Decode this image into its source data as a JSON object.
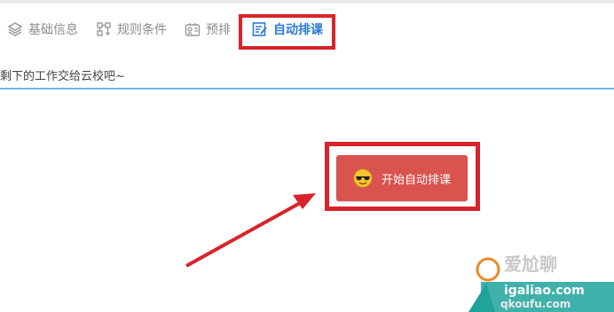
{
  "tabs": [
    {
      "label": "基础信息",
      "icon": "layers-icon",
      "active": false
    },
    {
      "label": "规则条件",
      "icon": "rules-icon",
      "active": false
    },
    {
      "label": "预排",
      "icon": "pre-schedule-icon",
      "active": false
    },
    {
      "label": "自动排课",
      "icon": "auto-schedule-icon",
      "active": true
    }
  ],
  "hint_text": "剩下的工作交给云校吧~",
  "start_button": {
    "label": "开始自动排课",
    "icon": "sunglasses-emoji-icon"
  },
  "watermark": {
    "line1": "爱尬聊",
    "line2": "igaliao.com",
    "line3": "qkoufu.com"
  },
  "colors": {
    "accent_blue": "#2b7cd3",
    "highlight_red": "#d8232a",
    "button_red": "#d9534f",
    "divider_blue": "#6fb6e6"
  }
}
